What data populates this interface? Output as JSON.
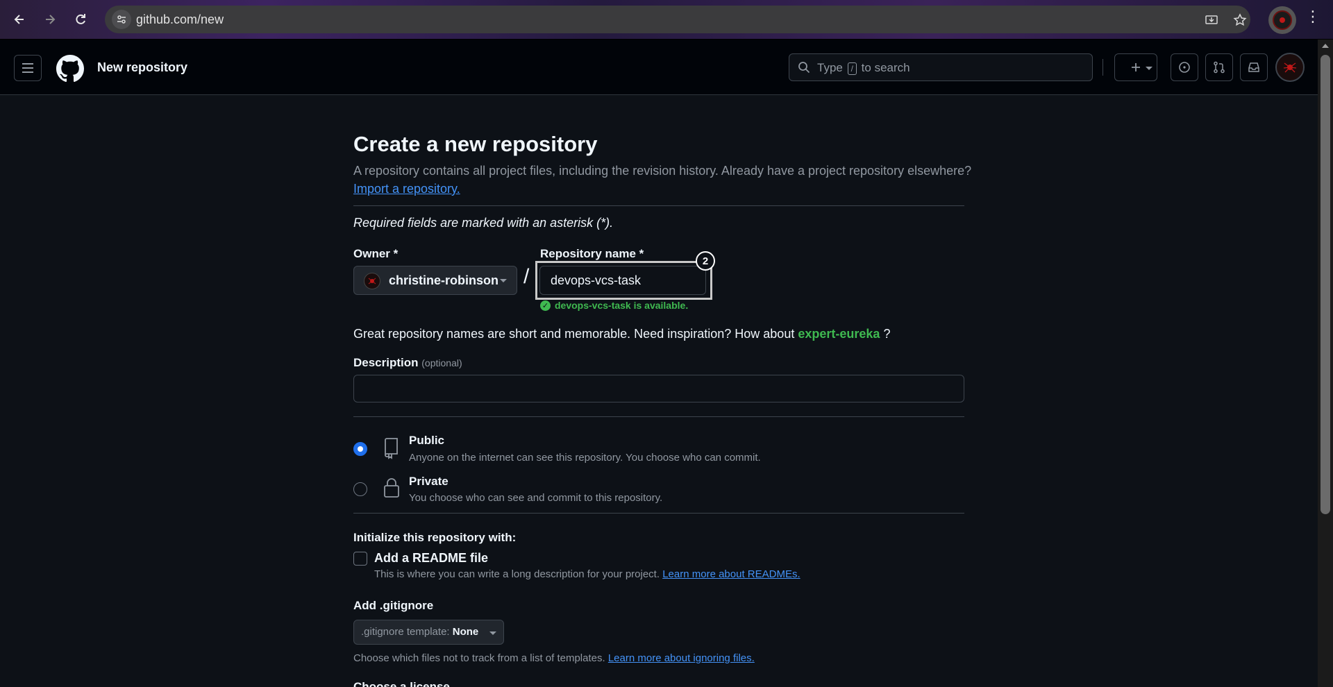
{
  "browser": {
    "url": "github.com/new"
  },
  "header": {
    "title": "New repository",
    "search_prefix": "Type",
    "search_key": "/",
    "search_suffix": "to search"
  },
  "form": {
    "title": "Create a new repository",
    "lead": "A repository contains all project files, including the revision history. Already have a project repository elsewhere?",
    "import_link": "Import a repository.",
    "required_note": "Required fields are marked with an asterisk (*).",
    "owner_label": "Owner *",
    "owner_value": "christine-robinson",
    "slash": "/",
    "name_label": "Repository name *",
    "name_value": "devops-vcs-task",
    "annotation_number": "2",
    "availability": "devops-vcs-task is available.",
    "suggest_prefix": "Great repository names are short and memorable. Need inspiration? How about",
    "suggest_name": "expert-eureka",
    "suggest_suffix": "?",
    "description_label": "Description",
    "description_optional": "(optional)",
    "description_value": "",
    "visibility": {
      "public_title": "Public",
      "public_desc": "Anyone on the internet can see this repository. You choose who can commit.",
      "private_title": "Private",
      "private_desc": "You choose who can see and commit to this repository.",
      "selected": "public"
    },
    "init_label": "Initialize this repository with:",
    "readme_title": "Add a README file",
    "readme_desc": "This is where you can write a long description for your project.",
    "readme_link": "Learn more about READMEs.",
    "readme_checked": false,
    "gitignore_label": "Add .gitignore",
    "gitignore_prefix": ".gitignore template:",
    "gitignore_value": "None",
    "gitignore_help": "Choose which files not to track from a list of templates.",
    "gitignore_link": "Learn more about ignoring files.",
    "cutoff_label": "Choose a license"
  },
  "colors": {
    "bg": "#0d1117",
    "header_bg": "#010409",
    "accent_blue": "#4493f8",
    "success_green": "#3fb950"
  }
}
